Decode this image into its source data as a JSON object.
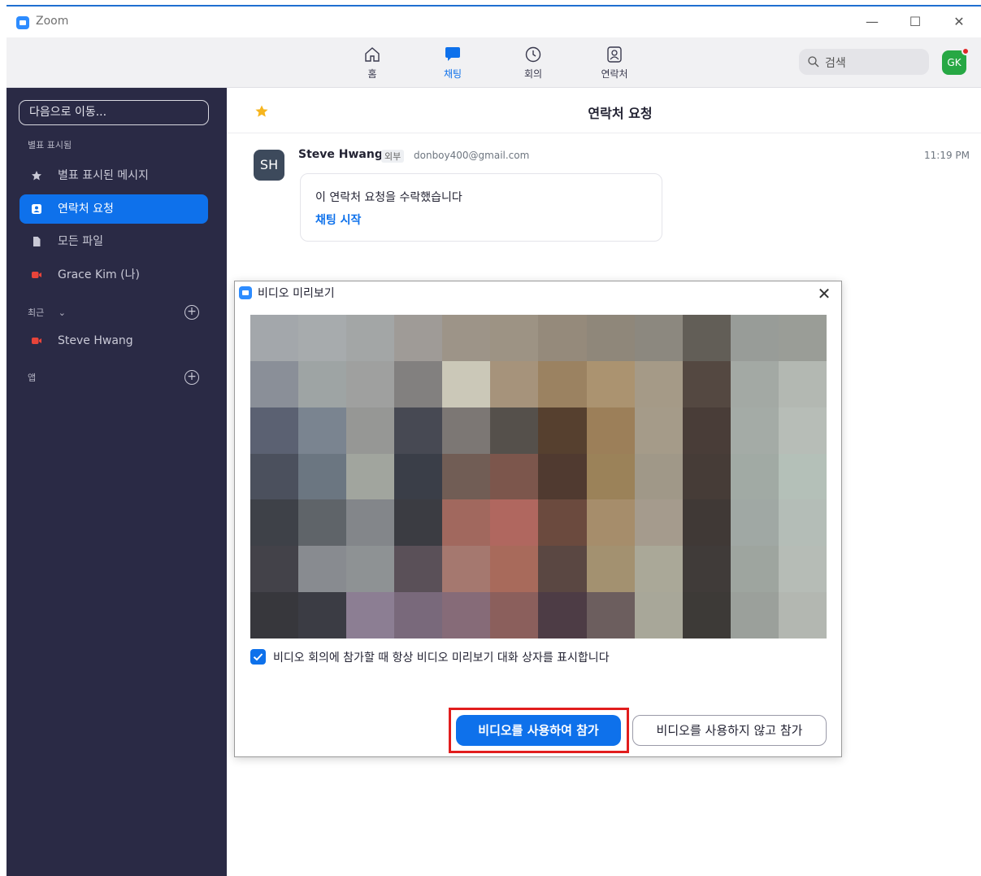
{
  "window": {
    "title": "Zoom",
    "minimize": "—",
    "maximize": "☐",
    "close": "✕"
  },
  "nav": {
    "tabs": [
      {
        "label": "홈",
        "icon": "home-icon"
      },
      {
        "label": "채팅",
        "icon": "chat-icon",
        "active": true
      },
      {
        "label": "회의",
        "icon": "clock-icon"
      },
      {
        "label": "연락처",
        "icon": "contacts-icon"
      }
    ],
    "search_label": "검색",
    "user_initials": "GK"
  },
  "sidebar": {
    "jump_to": "다음으로 이동...",
    "starred_section": "별표 표시됨",
    "items": [
      {
        "label": "별표 표시된 메시지",
        "icon": "star-icon"
      },
      {
        "label": "연락처 요청",
        "icon": "contact-card-icon",
        "selected": true
      },
      {
        "label": "모든 파일",
        "icon": "file-icon"
      },
      {
        "label": "Grace Kim (나)",
        "icon": "video-icon"
      }
    ],
    "recent_section": "최근",
    "recent_items": [
      {
        "label": "Steve Hwang",
        "icon": "video-icon"
      }
    ],
    "apps_section": "앱"
  },
  "content": {
    "title": "연락처 요청",
    "message": {
      "avatar": "SH",
      "sender": "Steve Hwang",
      "badge": "외부",
      "email": "donboy400@gmail.com",
      "time": "11:19 PM",
      "text": "이 연락처 요청을 수락했습니다",
      "link": "채팅 시작"
    }
  },
  "dialog": {
    "title": "비디오 미리보기",
    "checkbox_label": "비디오 회의에 참가할 때 항상 비디오 미리보기 대화 상자를 표시합니다",
    "checkbox_checked": true,
    "join_with_video": "비디오를 사용하여 참가",
    "join_without_video": "비디오를 사용하지 않고 참가"
  },
  "colors": {
    "accent": "#0e71eb",
    "sidebar": "#2a2a45",
    "highlight": "#e11d1d"
  }
}
